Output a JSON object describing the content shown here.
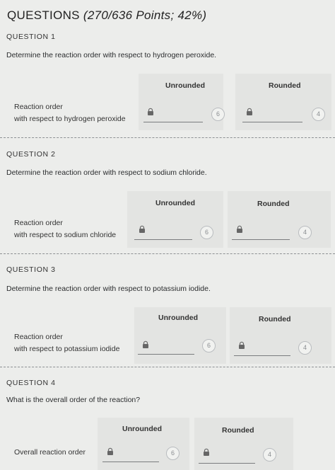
{
  "header": {
    "title": "QUESTIONS",
    "points": "(270/636 Points; 42%)"
  },
  "columns": {
    "unrounded": "Unrounded",
    "rounded": "Rounded"
  },
  "questions": [
    {
      "label": "QUESTION 1",
      "prompt": "Determine the reaction order with respect to hydrogen peroxide.",
      "row_line1": "Reaction order",
      "row_line2": "with respect to hydrogen peroxide",
      "unrounded_badge": "6",
      "rounded_badge": "4"
    },
    {
      "label": "QUESTION 2",
      "prompt": "Determine the reaction order with respect to sodium chloride.",
      "row_line1": "Reaction order",
      "row_line2": "with respect to sodium chloride",
      "unrounded_badge": "6",
      "rounded_badge": "4"
    },
    {
      "label": "QUESTION 3",
      "prompt": "Determine the reaction order with respect to potassium iodide.",
      "row_line1": "Reaction order",
      "row_line2": "with respect to potassium iodide",
      "unrounded_badge": "6",
      "rounded_badge": "4"
    },
    {
      "label": "QUESTION 4",
      "prompt": "What is the overall order of the reaction?",
      "row_line1": "Overall reaction order",
      "row_line2": "",
      "unrounded_badge": "6",
      "rounded_badge": "4"
    }
  ]
}
